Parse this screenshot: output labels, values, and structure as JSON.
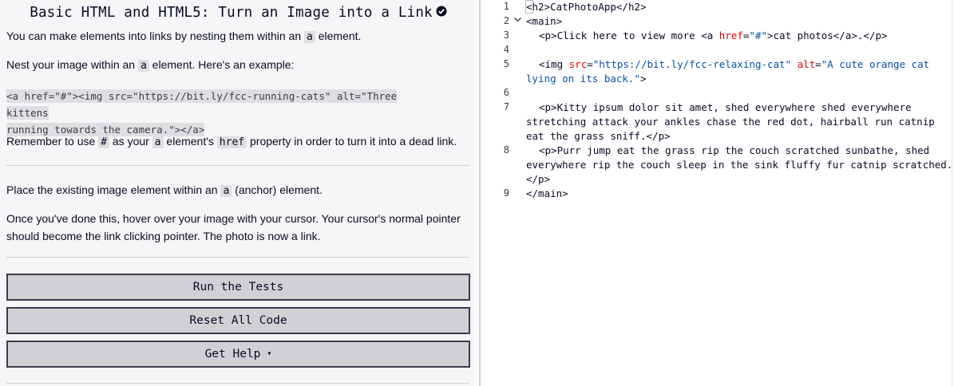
{
  "challenge": {
    "title": "Basic HTML and HTML5: Turn an Image into a Link",
    "description": {
      "p1_before": "You can make elements into links by nesting them within an ",
      "p1_code": "a",
      "p1_after": " element.",
      "p2_before": "Nest your image within an ",
      "p2_code": "a",
      "p2_after": " element. Here's an example:",
      "example_line1": "<a href=\"#\"><img src=\"https://bit.ly/fcc-running-cats\" alt=\"Three kittens",
      "example_line2": "running towards the camera.\"></a>",
      "p3_before": "Remember to use ",
      "p3_code1": "#",
      "p3_mid1": " as your ",
      "p3_code2": "a",
      "p3_mid2": " element's ",
      "p3_code3": "href",
      "p3_after": " property in order to turn it into a dead link."
    },
    "instructions": {
      "p1_before": "Place the existing image element within an ",
      "p1_code": "a",
      "p1_after": " (anchor) element.",
      "p2_line1": "Once you've done this, hover over your image with your cursor. Your cursor's normal pointer",
      "p2_line2": "should become the link clicking pointer. The photo is now a link."
    }
  },
  "buttons": {
    "run_tests": "Run the Tests",
    "reset_code": "Reset All Code",
    "get_help": "Get Help"
  },
  "editor": {
    "line_numbers": [
      "1",
      "2",
      "3",
      "4",
      "5",
      "6",
      "7",
      "8",
      "9"
    ],
    "line1": {
      "pre": "",
      "bracket": "<",
      "post": "h2>CatPhotoApp</h2>"
    },
    "line2": "<main>",
    "line3": {
      "pre": "<p>Click here to view more <a ",
      "attr": "href",
      "eq": "=",
      "str": "\"#\"",
      "post": ">cat photos</a>.</p>"
    },
    "line5": {
      "pre": "<img ",
      "attr1": "src",
      "eq1": "=",
      "str1": "\"https://bit.ly/fcc-relaxing-cat\"",
      "sp": " ",
      "attr2": "alt",
      "eq2": "=",
      "str2a": "\"A cute orange cat",
      "str2b": "lying on its back.\"",
      "post": ">"
    },
    "line7a": "<p>Kitty ipsum dolor sit amet, shed everywhere shed everywhere",
    "line7b": "stretching attack your ankles chase the red dot, hairball run catnip",
    "line7c": "eat the grass sniff.</p>",
    "line8a": "<p>Purr jump eat the grass rip the couch scratched sunbathe, shed",
    "line8b": "everywhere rip the couch sleep in the sink fluffy fur catnip scratched.",
    "line8c": "</p>",
    "line9": "</main>"
  },
  "colors": {
    "accent_dark": "#0a0a23",
    "panel_bg": "#f5f6f7",
    "inline_code_bg": "#dfdfe2",
    "attr": "#e50000",
    "string": "#0451a5"
  }
}
